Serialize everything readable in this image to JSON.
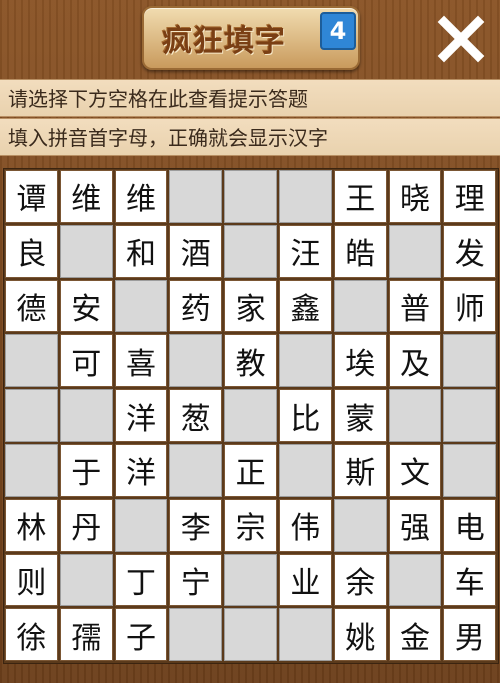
{
  "header": {
    "title": "疯狂填字",
    "badge": "4",
    "close_icon": "close-icon"
  },
  "hints": [
    "请选择下方空格在此查看提示答题",
    "填入拼音首字母，正确就会显示汉字"
  ],
  "grid": [
    [
      "谭",
      "维",
      "维",
      "",
      "",
      "",
      "王",
      "晓",
      "理"
    ],
    [
      "良",
      "",
      "和",
      "酒",
      "",
      "汪",
      "皓",
      "",
      "发"
    ],
    [
      "德",
      "安",
      "",
      "药",
      "家",
      "鑫",
      "",
      "普",
      "师"
    ],
    [
      "",
      "可",
      "喜",
      "",
      "教",
      "",
      "埃",
      "及",
      ""
    ],
    [
      "",
      "",
      "洋",
      "葱",
      "",
      "比",
      "蒙",
      "",
      ""
    ],
    [
      "",
      "于",
      "洋",
      "",
      "正",
      "",
      "斯",
      "文",
      ""
    ],
    [
      "林",
      "丹",
      "",
      "李",
      "宗",
      "伟",
      "",
      "强",
      "电"
    ],
    [
      "则",
      "",
      "丁",
      "宁",
      "",
      "业",
      "余",
      "",
      "车"
    ],
    [
      "徐",
      "孺",
      "子",
      "",
      "",
      "",
      "姚",
      "金",
      "男"
    ]
  ],
  "colors": {
    "wood": "#7a4a22",
    "hint_bg": "#eed8b7",
    "cell_filled": "#ffffff",
    "cell_empty": "#d8d8d8",
    "badge": "#2f86d6"
  }
}
